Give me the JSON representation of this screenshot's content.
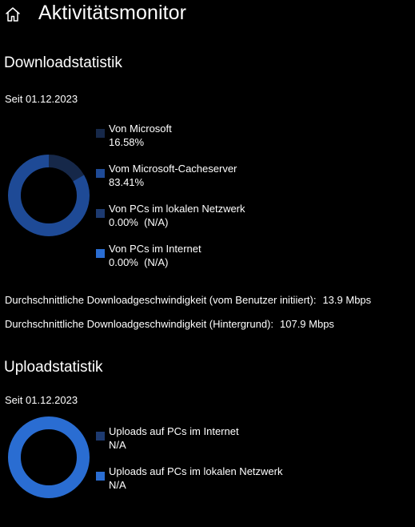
{
  "header": {
    "title": "Aktivitätsmonitor",
    "home_icon": "home-icon"
  },
  "colors": {
    "background": "#000000",
    "text": "#ffffff",
    "dark_segment": "#162849",
    "mid_segment": "#1e4a96",
    "bright_segment": "#2a6dd2"
  },
  "download": {
    "heading": "Downloadstatistik",
    "since": "Seit 01.12.2023",
    "legend": [
      {
        "label": "Von Microsoft",
        "value": "16.58%",
        "color": "#162849"
      },
      {
        "label": "Vom Microsoft-Cacheserver",
        "value": "83.41%",
        "color": "#1e4a96"
      },
      {
        "label": "Von PCs im lokalen Netzwerk",
        "value": "0.00%  (N/A)",
        "color": "#1d3a70"
      },
      {
        "label": "Von PCs im Internet",
        "value": "0.00%  (N/A)",
        "color": "#2a6dd2"
      }
    ],
    "avg_user_label": "Durchschnittliche Downloadgeschwindigkeit (vom Benutzer initiiert):",
    "avg_user_value": "13.9 Mbps",
    "avg_background_label": "Durchschnittliche Downloadgeschwindigkeit (Hintergrund):",
    "avg_background_value": "107.9 Mbps"
  },
  "upload": {
    "heading": "Uploadstatistik",
    "since": "Seit 01.12.2023",
    "legend": [
      {
        "label": "Uploads auf PCs im Internet",
        "value": "N/A",
        "color": "#1d3a70"
      },
      {
        "label": "Uploads auf PCs im lokalen Netzwerk",
        "value": "N/A",
        "color": "#2a6dd2"
      }
    ]
  },
  "chart_data": [
    {
      "type": "pie",
      "categories": [
        "Von Microsoft",
        "Vom Microsoft-Cacheserver",
        "Von PCs im lokalen Netzwerk",
        "Von PCs im Internet"
      ],
      "values": [
        16.58,
        83.41,
        0.0,
        0.0
      ],
      "colors": [
        "#162849",
        "#1e4a96",
        "#1d3a70",
        "#2a6dd2"
      ],
      "style": "donut"
    },
    {
      "type": "pie",
      "categories": [
        "Uploads auf PCs im Internet",
        "Uploads auf PCs im lokalen Netzwerk"
      ],
      "values": [
        0,
        0
      ],
      "colors": [
        "#1d3a70",
        "#2a6dd2"
      ],
      "style": "donut",
      "empty_ring_color": "#2a6dd2"
    }
  ]
}
